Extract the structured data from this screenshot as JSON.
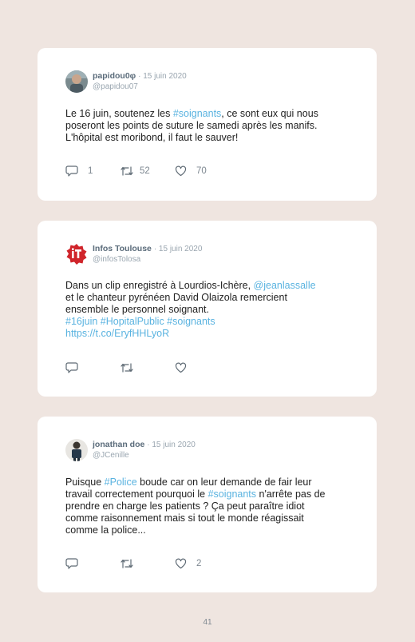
{
  "tweets": [
    {
      "name": "papidou0φ",
      "date": "· 15 juin 2020",
      "handle": "@papidou07",
      "text": {
        "l1a": "Le 16 juin, soutenez les ",
        "l1b": "#soignants",
        "l1c": ", ce sont eux qui nous",
        "l2": "poseront les points de suture le samedi après les manifs.",
        "l3": "L'hôpital est moribond, il faut le sauver!"
      },
      "replies": "1",
      "retweets": "52",
      "likes": "70"
    },
    {
      "name": "Infos Toulouse",
      "date": "· 15 juin 2020",
      "handle": "@infosTolosa",
      "text": {
        "l1a": "Dans un clip enregistré à Lourdios-Ichère, ",
        "l1b": "@jeanlassalle",
        "l2": "et le chanteur pyrénéen David Olaizola remercient",
        "l3": "ensemble le personnel soignant.",
        "l4": "#16juin #HopitalPublic #soignants",
        "l5": "https://t.co/EryfHHLyoR"
      },
      "replies": "",
      "retweets": "",
      "likes": ""
    },
    {
      "name": "jonathan doe",
      "date": "· 15 juin 2020",
      "handle": "@JCenille",
      "text": {
        "l1a": "Puisque ",
        "l1b": "#Police",
        "l1c": " boude car on leur demande de fair leur",
        "l2a": "travail correctement pourquoi le ",
        "l2b": "#soignants",
        "l2c": " n'arrête pas de",
        "l3": "prendre en charge les patients ? Ça peut paraître idiot",
        "l4": "comme raisonnement mais si tout le monde réagissait",
        "l5": "comme la police..."
      },
      "replies": "",
      "retweets": "",
      "likes": "2"
    }
  ],
  "page_number": "41",
  "colors": {
    "link": "#5ab3e0",
    "background": "#efe5e0",
    "logo_red": "#d0252b"
  },
  "icons": {
    "reply": "speech-bubble-icon",
    "retweet": "retweet-icon",
    "like": "heart-icon"
  }
}
